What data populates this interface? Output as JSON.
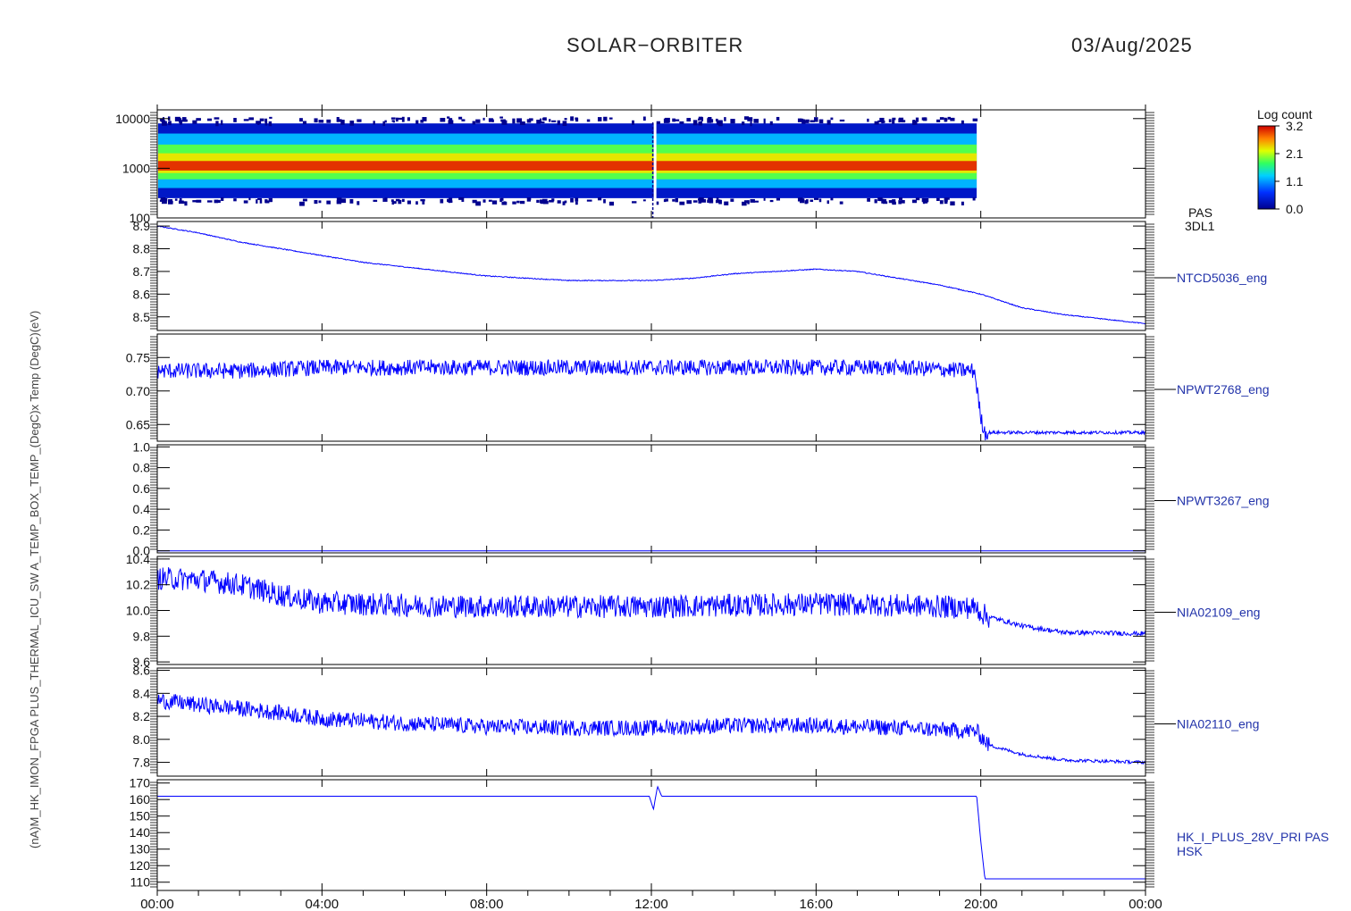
{
  "header": {
    "mission": "SOLAR−ORBITER",
    "date": "03/Aug/2025"
  },
  "colors": {
    "trace": "#0000ff",
    "label": "#2233aa",
    "frame": "#000000"
  },
  "y_axis_overlap_text": "(nA)M_HK_IMON_FPGA PLUS_THERMAL_ICU_SW A_TEMP_BOX_TEMP_(DegC)x Temp (DegC)(eV)",
  "colorbar": {
    "title": "Log count",
    "ticks": [
      "3.2",
      "2.1",
      "1.1",
      "0.0"
    ]
  },
  "chart_data": [
    {
      "type": "heatmap",
      "panel": "spectrogram",
      "label_lines": [
        "PAS",
        "3DL1"
      ],
      "y_scale": "log",
      "ylim": [
        100,
        15000
      ],
      "yticks": [
        "10000",
        "1000",
        "100"
      ],
      "data_end_hour": 19.9,
      "data_gap_hour": 12.1,
      "bands": [
        {
          "low": 250,
          "high": 8000,
          "level": 0.3
        },
        {
          "low": 400,
          "high": 5000,
          "level": 1.1
        },
        {
          "low": 600,
          "high": 3000,
          "level": 1.8
        },
        {
          "low": 800,
          "high": 2000,
          "level": 2.3
        },
        {
          "low": 900,
          "high": 1400,
          "level": 3.0
        }
      ],
      "color_scale": [
        0.0,
        3.2
      ]
    },
    {
      "type": "line",
      "label": "NTCD5036_eng",
      "ylim": [
        8.44,
        8.92
      ],
      "yticks": [
        "8.9",
        "8.8",
        "8.7",
        "8.6",
        "8.5"
      ],
      "x": [
        0,
        1,
        2,
        3,
        4,
        5,
        6,
        7,
        8,
        9,
        10,
        11,
        12,
        13,
        14,
        15,
        16,
        17,
        18,
        19,
        20,
        21,
        22,
        23,
        24
      ],
      "y": [
        8.9,
        8.87,
        8.83,
        8.8,
        8.77,
        8.74,
        8.72,
        8.7,
        8.68,
        8.67,
        8.66,
        8.66,
        8.66,
        8.67,
        8.69,
        8.7,
        8.71,
        8.7,
        8.67,
        8.64,
        8.6,
        8.54,
        8.51,
        8.49,
        8.47
      ]
    },
    {
      "type": "line",
      "label": "NPWT2768_eng",
      "ylim": [
        0.625,
        0.785
      ],
      "yticks": [
        "0.75",
        "0.70",
        "0.65"
      ],
      "x": [
        0,
        2,
        4,
        6,
        8,
        10,
        12,
        14,
        16,
        18,
        19.85,
        20.0,
        20.1,
        22,
        24
      ],
      "y": [
        0.73,
        0.73,
        0.735,
        0.735,
        0.735,
        0.735,
        0.735,
        0.735,
        0.735,
        0.735,
        0.73,
        0.66,
        0.638,
        0.638,
        0.638
      ]
    },
    {
      "type": "line",
      "label": "NPWT3267_eng",
      "ylim": [
        -0.02,
        1.02
      ],
      "yticks": [
        "1.0",
        "0.8",
        "0.6",
        "0.4",
        "0.2",
        "0.0"
      ],
      "x": [
        0,
        24
      ],
      "y": [
        0.0,
        0.0
      ]
    },
    {
      "type": "line",
      "label": "NIA02109_eng",
      "ylim": [
        9.58,
        10.42
      ],
      "yticks": [
        "10.4",
        "10.2",
        "10.0",
        "9.8",
        "9.6"
      ],
      "x": [
        0,
        1,
        2,
        3,
        4,
        6,
        8,
        10,
        12,
        14,
        16,
        18,
        19.9,
        20.1,
        21,
        22,
        24
      ],
      "y": [
        10.25,
        10.24,
        10.2,
        10.12,
        10.06,
        10.04,
        10.03,
        10.03,
        10.03,
        10.04,
        10.05,
        10.04,
        10.02,
        9.96,
        9.88,
        9.83,
        9.82
      ]
    },
    {
      "type": "line",
      "label": "NIA02110_eng",
      "ylim": [
        7.68,
        8.62
      ],
      "yticks": [
        "8.6",
        "8.4",
        "8.2",
        "8.0",
        "7.8"
      ],
      "x": [
        0,
        1,
        2,
        3,
        4,
        6,
        8,
        10,
        12,
        14,
        16,
        18,
        19.9,
        20.2,
        21,
        22,
        24
      ],
      "y": [
        8.34,
        8.3,
        8.27,
        8.23,
        8.18,
        8.14,
        8.11,
        8.1,
        8.1,
        8.12,
        8.12,
        8.1,
        8.07,
        7.95,
        7.87,
        7.82,
        7.8
      ]
    },
    {
      "type": "line",
      "label_lines": [
        "HK_I_PLUS_28V_PRI PAS",
        "HSK"
      ],
      "ylim": [
        105,
        172
      ],
      "yticks": [
        "170",
        "160",
        "150",
        "140",
        "130",
        "120",
        "110"
      ],
      "x": [
        0,
        11.95,
        12.05,
        12.15,
        12.25,
        19.9,
        20.0,
        20.1,
        24
      ],
      "y": [
        162,
        162,
        154,
        168,
        162,
        162,
        135,
        112,
        112
      ]
    }
  ],
  "xaxis": {
    "xlim": [
      0,
      24
    ],
    "tick_hours": [
      0,
      4,
      8,
      12,
      16,
      20,
      24
    ],
    "tick_labels": [
      "00:00",
      "04:00",
      "08:00",
      "12:00",
      "16:00",
      "20:00",
      "00:00"
    ]
  }
}
